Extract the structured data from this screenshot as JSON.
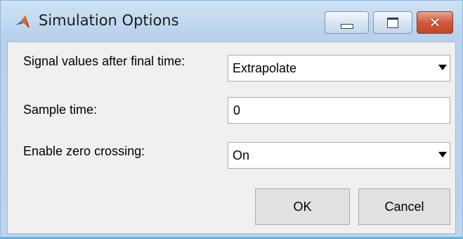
{
  "window": {
    "title": "Simulation Options",
    "icon": "matlab-logo-icon",
    "controls": {
      "minimize": "minimize-icon",
      "maximize": "maximize-icon",
      "close": "close-icon"
    },
    "accent": "#5ab7e0"
  },
  "form": {
    "signal_values": {
      "label": "Signal values after final time:",
      "value": "Extrapolate"
    },
    "sample_time": {
      "label": "Sample time:",
      "value": "0"
    },
    "zero_crossing": {
      "label": "Enable zero crossing:",
      "value": "On"
    }
  },
  "buttons": {
    "ok": "OK",
    "cancel": "Cancel"
  }
}
